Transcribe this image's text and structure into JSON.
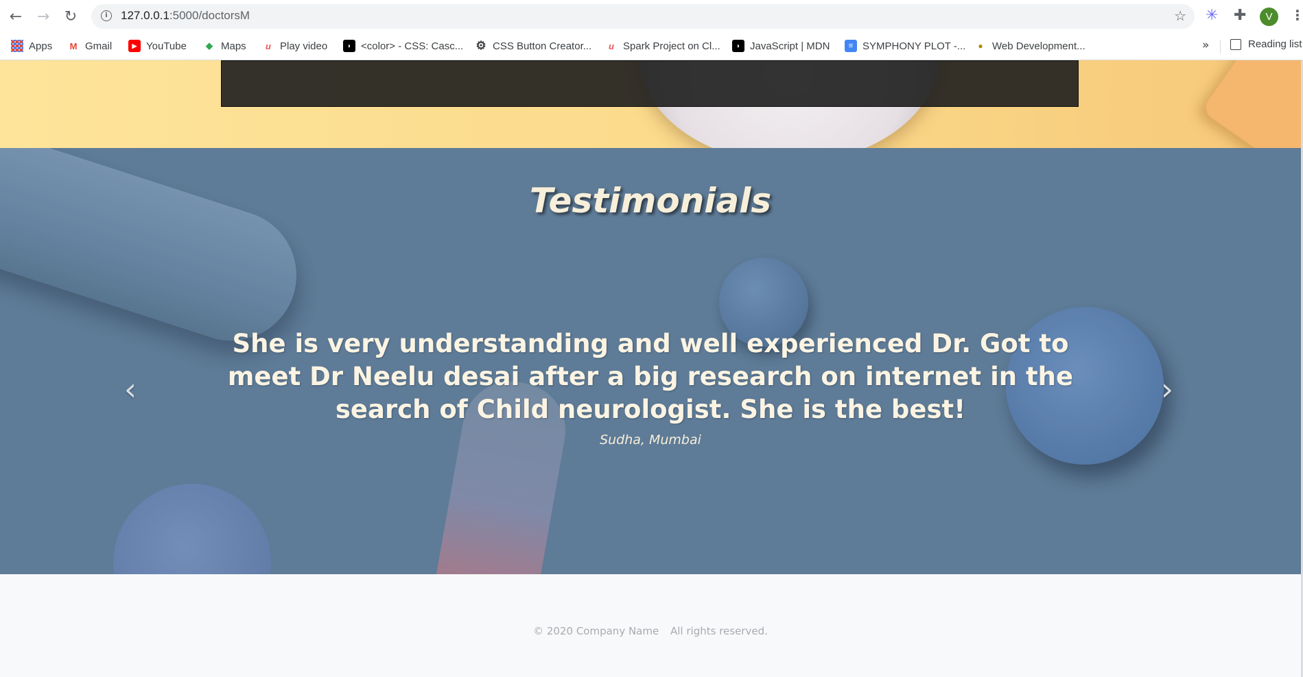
{
  "browser": {
    "url_host": "127.0.0.1",
    "url_path": ":5000/doctorsM",
    "avatar_letter": "V",
    "bookmarks": [
      {
        "label": "Apps",
        "icon": "apps-grid-icon"
      },
      {
        "label": "Gmail",
        "icon": "gmail-icon"
      },
      {
        "label": "YouTube",
        "icon": "youtube-icon"
      },
      {
        "label": "Maps",
        "icon": "maps-icon"
      },
      {
        "label": "Play video",
        "icon": "udemy-icon"
      },
      {
        "label": "<color> - CSS: Casc...",
        "icon": "mdn-icon"
      },
      {
        "label": "CSS Button Creator...",
        "icon": "gear-icon"
      },
      {
        "label": "Spark Project on Cl...",
        "icon": "udemy-icon"
      },
      {
        "label": "JavaScript | MDN",
        "icon": "mdn-icon"
      },
      {
        "label": "SYMPHONY PLOT -...",
        "icon": "docs-icon"
      },
      {
        "label": "Web Development...",
        "icon": "web-dev-icon"
      }
    ],
    "more_label": "»",
    "reading_list_label": "Reading list"
  },
  "testimonials": {
    "title": "Testimonials",
    "quote": "She is very understanding and well experienced Dr. Got to meet Dr Neelu desai after a big research on internet in the search of Child neurologist. She is the best!",
    "author": "Sudha, Mumbai",
    "prev_symbol": "‹",
    "next_symbol": "›"
  },
  "footer": {
    "copyright": "© 2020 Company Name",
    "rights": "All rights reserved."
  },
  "colors": {
    "testimonial_bg": "#5e7b97",
    "title_text": "#f7efda",
    "footer_text": "#a6abb1",
    "hero_yellow": "#fde49a"
  }
}
